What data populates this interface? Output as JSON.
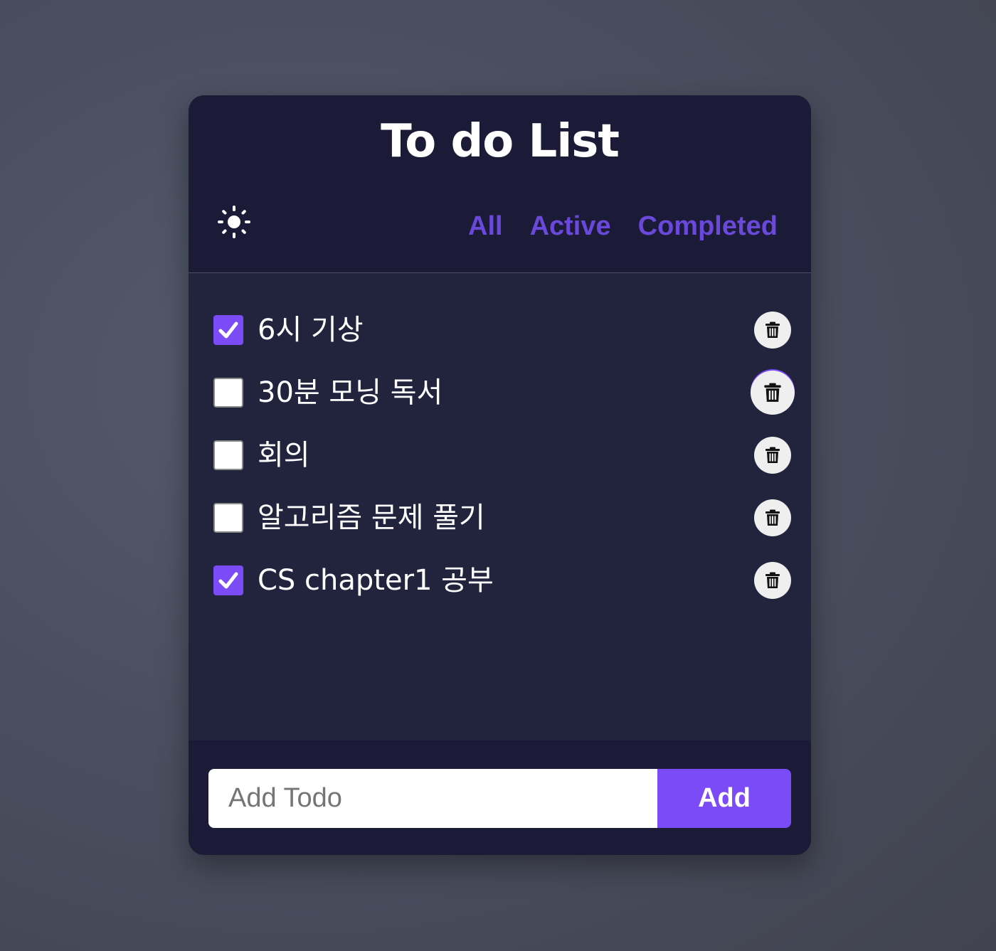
{
  "header": {
    "title": "To do List",
    "theme_toggle_icon": "sun-icon",
    "filters": [
      {
        "label": "All"
      },
      {
        "label": "Active"
      },
      {
        "label": "Completed"
      }
    ],
    "filter_color": "#6a48d9"
  },
  "todos": [
    {
      "text": "6시 기상",
      "completed": true
    },
    {
      "text": "30분 모닝 독서",
      "completed": false
    },
    {
      "text": "회의",
      "completed": false
    },
    {
      "text": "알고리즘 문제 풀기",
      "completed": false
    },
    {
      "text": "CS chapter1 공부",
      "completed": true
    }
  ],
  "delete_icon": "trash-icon",
  "add_form": {
    "placeholder": "Add Todo",
    "button_label": "Add"
  },
  "colors": {
    "accent": "#7c4bf8",
    "card_bg": "#22233d",
    "header_bg": "#1b1b38"
  }
}
